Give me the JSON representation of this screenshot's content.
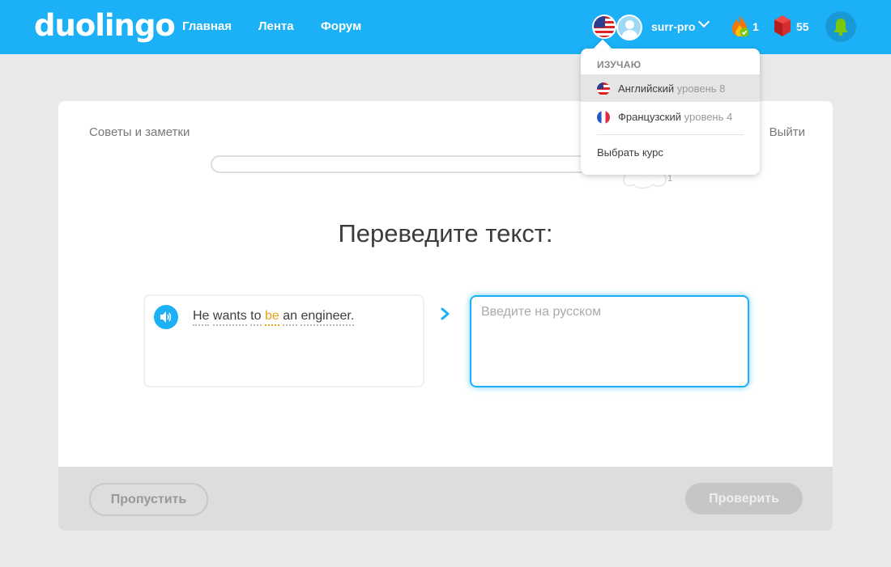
{
  "header": {
    "logo": "duolingo",
    "nav": {
      "home": "Главная",
      "feed": "Лента",
      "forum": "Форум"
    },
    "username": "surr-pro",
    "streak": "1",
    "gems": "55"
  },
  "lesson": {
    "tips": "Советы и заметки",
    "exit": "Выйти",
    "progress_badge": "1",
    "prompt": "Переведите текст:",
    "sentence": [
      "He",
      "wants",
      "to",
      "be",
      "an",
      "engineer."
    ],
    "highlighted_word": "be",
    "answer_placeholder": "Введите на русском",
    "answer_value": ""
  },
  "footer": {
    "skip": "Пропустить",
    "check": "Проверить"
  },
  "dropdown": {
    "header": "ИЗУЧАЮ",
    "courses": [
      {
        "language": "Английский",
        "level": "уровень 8",
        "flag": "us-flag-icon",
        "active": true
      },
      {
        "language": "Французский",
        "level": "уровень 4",
        "flag": "fr-flag-icon",
        "active": false
      }
    ],
    "choose_course": "Выбрать курс"
  },
  "colors": {
    "brand": "#1cb0f6",
    "highlight": "#e8a218",
    "background": "#e9e9e9"
  }
}
